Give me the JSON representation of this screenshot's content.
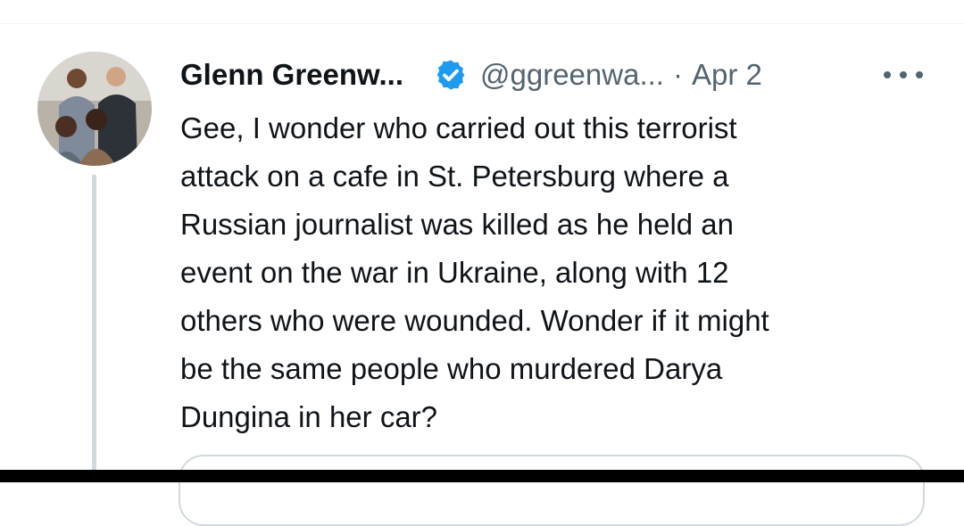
{
  "tweet": {
    "author_name": "Glenn Greenw...",
    "verified_icon": "verified-badge-icon",
    "handle": "@ggreenwa...",
    "separator": "·",
    "date": "Apr 2",
    "more_icon": "more-options-icon",
    "text": "Gee, I wonder who carried out this terrorist\nattack on a cafe in St. Petersburg where a\nRussian journalist was killed as he held an\nevent on the war in Ukraine, along with 12\nothers who were wounded. Wonder if it might\nbe the same people who murdered Darya\nDungina in her car?"
  },
  "colors": {
    "text": "#0f1419",
    "secondary": "#536471",
    "verified": "#1d9bf0",
    "thread_line": "#cfd9de"
  }
}
